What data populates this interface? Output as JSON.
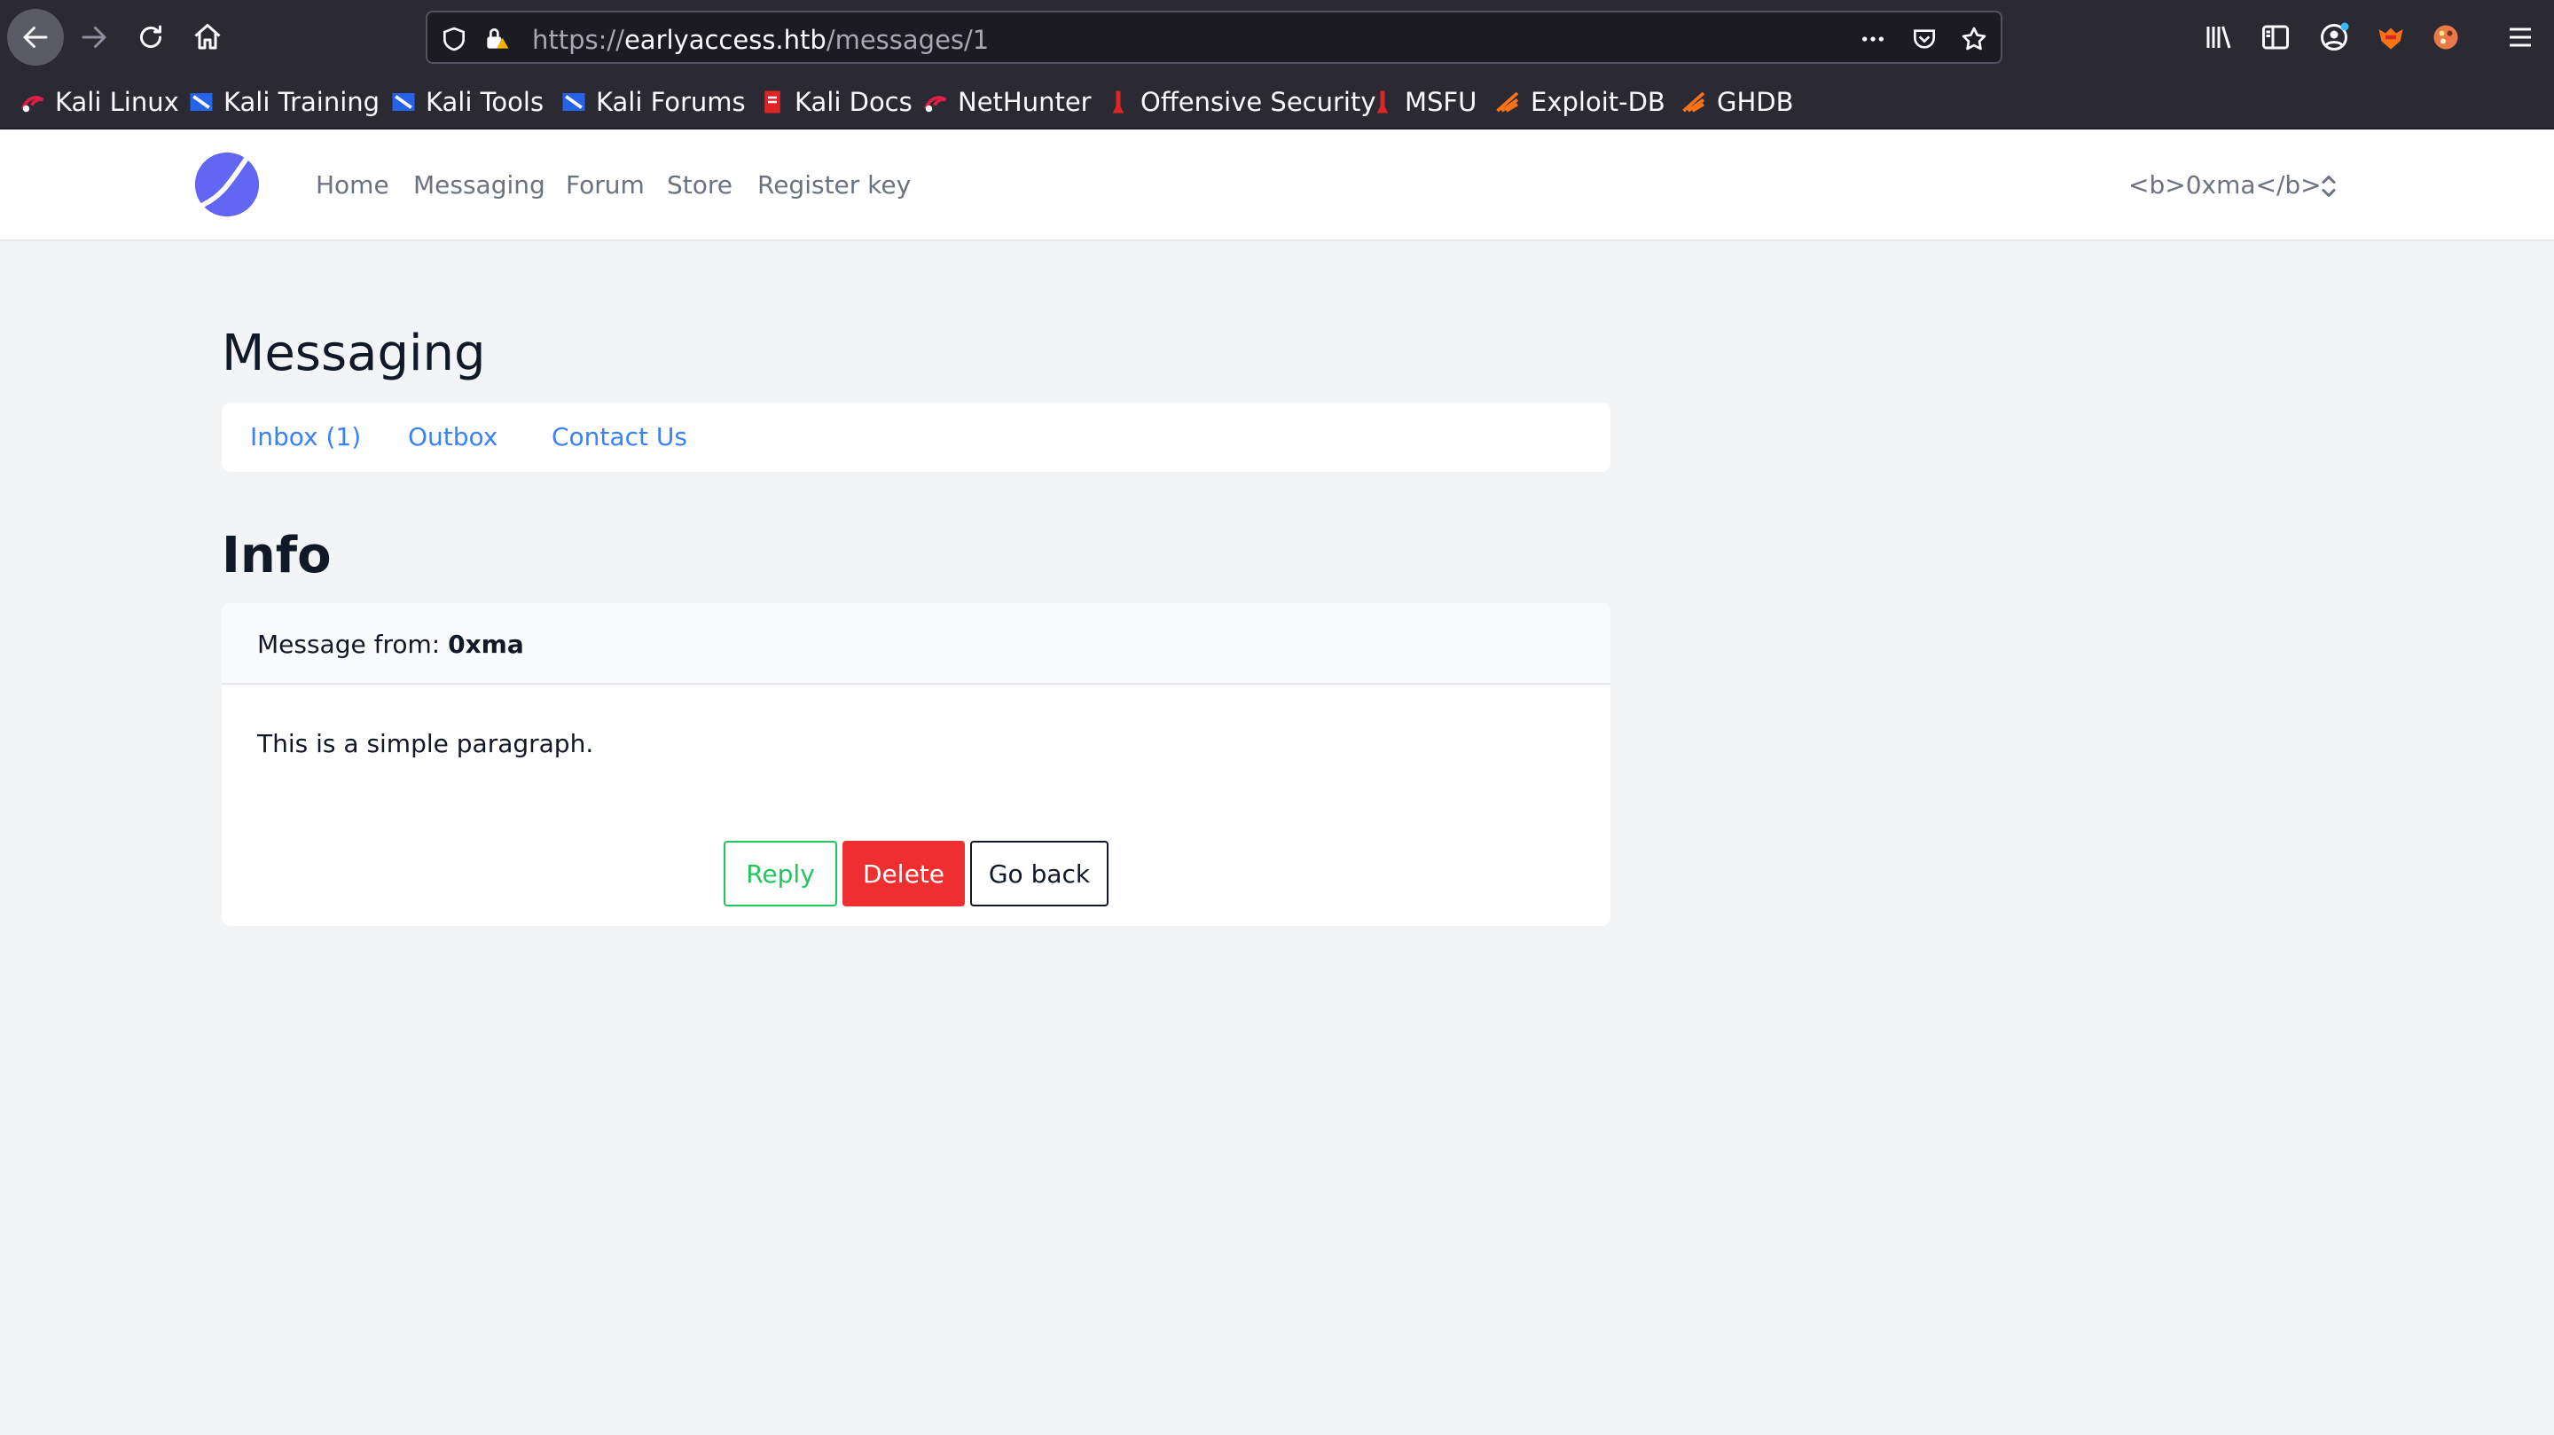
{
  "browser": {
    "url_prefix": "https://",
    "url_host": "earlyaccess.htb",
    "url_path": "/messages/1",
    "bookmarks": [
      {
        "label": "Kali Linux",
        "icon": "kali-dragon-icon"
      },
      {
        "label": "Kali Training",
        "icon": "kali-training-icon"
      },
      {
        "label": "Kali Tools",
        "icon": "kali-tools-icon"
      },
      {
        "label": "Kali Forums",
        "icon": "kali-forums-icon"
      },
      {
        "label": "Kali Docs",
        "icon": "kali-docs-icon"
      },
      {
        "label": "NetHunter",
        "icon": "nethunter-icon"
      },
      {
        "label": "Offensive Security",
        "icon": "offsec-icon"
      },
      {
        "label": "MSFU",
        "icon": "msfu-icon"
      },
      {
        "label": "Exploit-DB",
        "icon": "exploitdb-icon"
      },
      {
        "label": "GHDB",
        "icon": "ghdb-icon"
      }
    ]
  },
  "header": {
    "nav": [
      "Home",
      "Messaging",
      "Forum",
      "Store",
      "Register key"
    ],
    "user": "<b>0xma</b>"
  },
  "messaging": {
    "title": "Messaging",
    "tabs": [
      "Inbox (1)",
      "Outbox",
      "Contact Us"
    ]
  },
  "info": {
    "title": "Info",
    "from_label": "Message from:",
    "from_user": "0xma",
    "body": "This is a simple paragraph.",
    "buttons": {
      "reply": "Reply",
      "delete": "Delete",
      "back": "Go back"
    }
  },
  "colors": {
    "link": "#3b82f6",
    "reply": "#22c55e",
    "delete": "#ef2f2f",
    "logo": "#6366f1"
  }
}
